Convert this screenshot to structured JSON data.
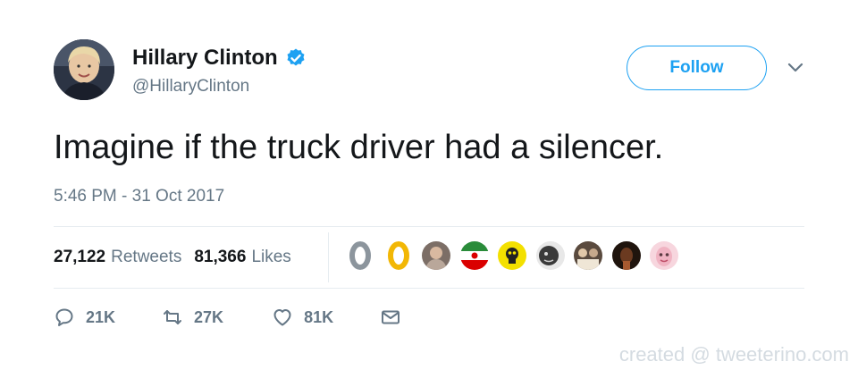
{
  "author": {
    "display_name": "Hillary Clinton",
    "handle": "@HillaryClinton",
    "verified": true,
    "avatar_icon": "profile-photo"
  },
  "follow_button": {
    "label": "Follow"
  },
  "menu_icon": "chevron-down-icon",
  "tweet": {
    "text": "Imagine if the truck driver had a silencer.",
    "timestamp": "5:46 PM - 31 Oct 2017"
  },
  "stats": {
    "retweets_count": "27,122",
    "retweets_label": "Retweets",
    "likes_count": "81,366",
    "likes_label": "Likes"
  },
  "liker_avatars": [
    {
      "icon": "grey-ring-avatar",
      "color": "#8c959d"
    },
    {
      "icon": "gold-ring-avatar",
      "color": "#f2b705"
    },
    {
      "icon": "person-avatar",
      "color": "#b9a79a"
    },
    {
      "icon": "iran-flag-avatar",
      "color": "#2a8c3a"
    },
    {
      "icon": "skull-yellow-avatar",
      "color": "#f3e000"
    },
    {
      "icon": "face-dark-avatar",
      "color": "#3a3a3a"
    },
    {
      "icon": "group-photo-avatar",
      "color": "#c7a98c"
    },
    {
      "icon": "dark-portrait-avatar",
      "color": "#4a2a1a"
    },
    {
      "icon": "pink-face-avatar",
      "color": "#f0b3c2"
    }
  ],
  "actions": {
    "reply_count": "21K",
    "retweet_count": "27K",
    "like_count": "81K"
  },
  "watermark": "created @ tweeterino.com",
  "colors": {
    "accent": "#1da1f2",
    "text_primary": "#14171a",
    "text_secondary": "#657786",
    "divider": "#e6ecf0"
  }
}
